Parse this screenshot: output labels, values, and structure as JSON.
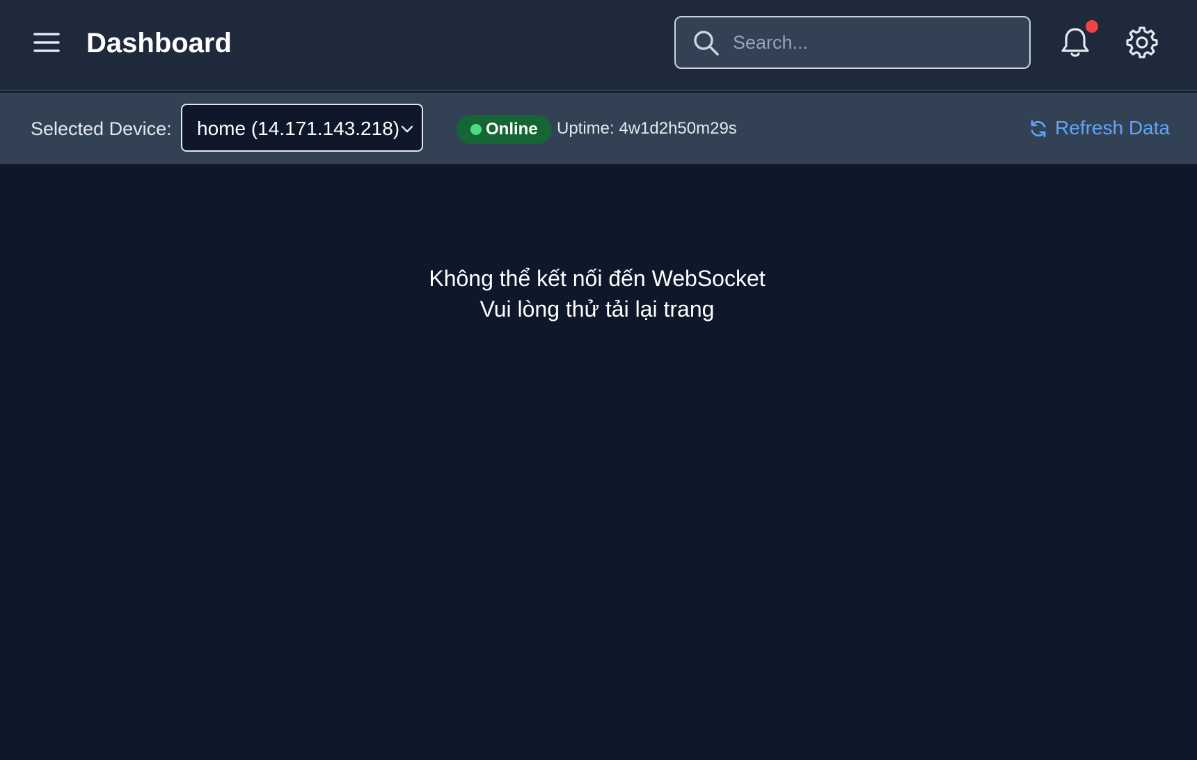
{
  "header": {
    "title": "Dashboard",
    "search": {
      "placeholder": "Search...",
      "value": ""
    },
    "notification_dot_color": "#ef4444",
    "icons": [
      "menu-icon",
      "search-icon",
      "bell-icon",
      "gear-icon"
    ]
  },
  "device_bar": {
    "label": "Selected Device:",
    "selected_device": "home (14.171.143.218)",
    "status": "Online",
    "status_color": "#4ade80",
    "uptime": "Uptime: 4w1d2h50m29s",
    "refresh_label": "Refresh Data",
    "accent_color": "#60a5fa"
  },
  "main": {
    "error_line_1": "Không thể kết nối đến WebSocket",
    "error_line_2": "Vui lòng thử tải lại trang"
  }
}
